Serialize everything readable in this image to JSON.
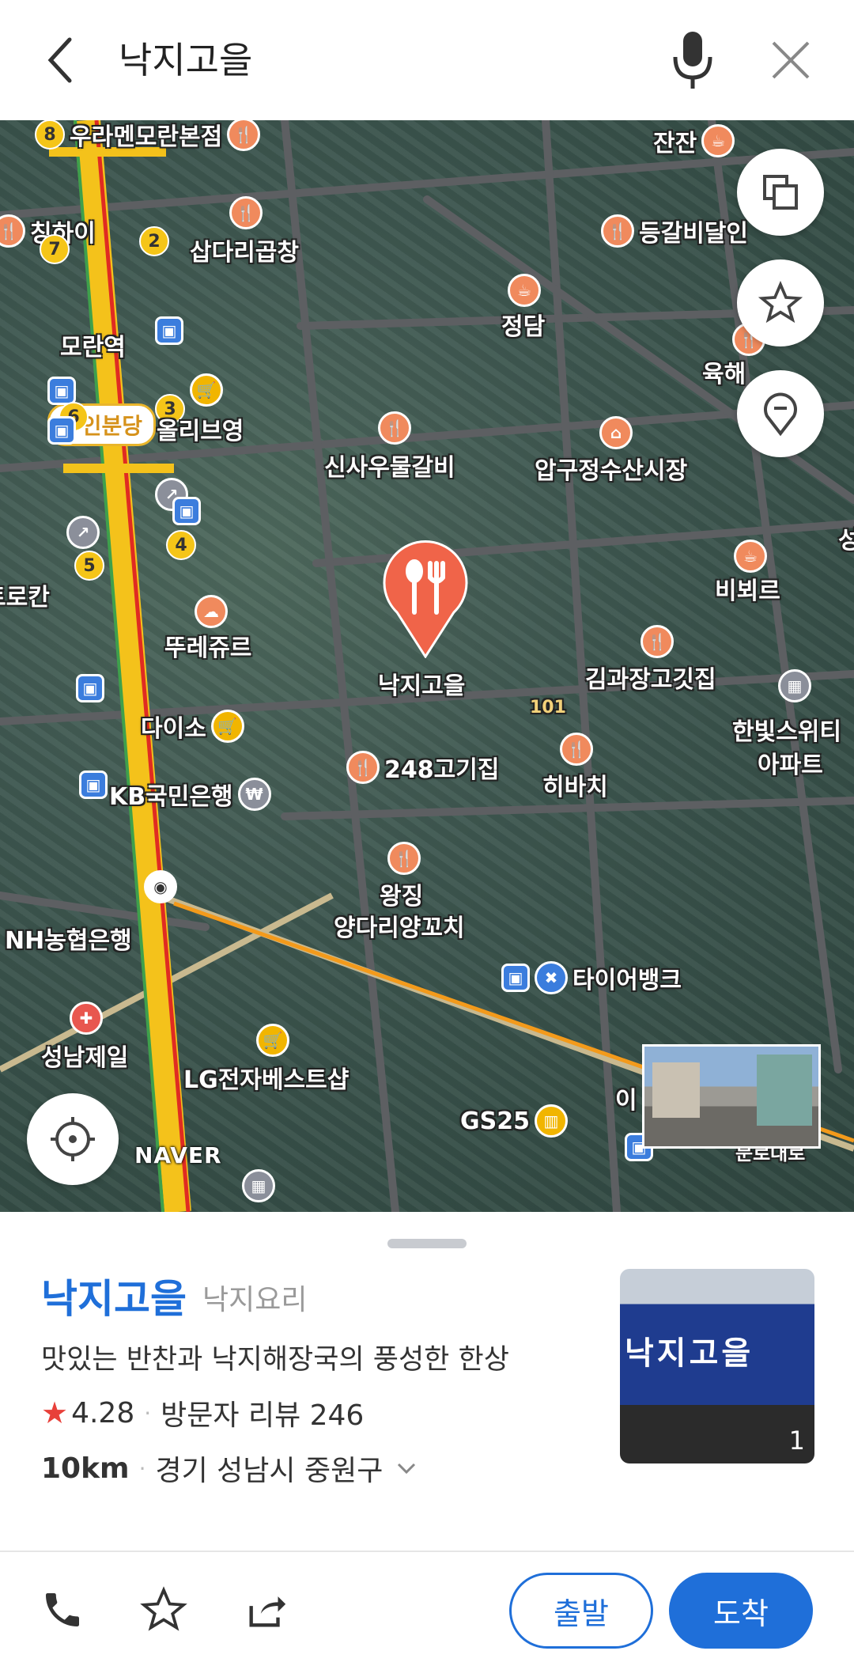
{
  "search": {
    "query": "낙지고을"
  },
  "map": {
    "station_badge": "수인분당",
    "labels": {
      "p1": "우라멘모란본점",
      "p2": "칭하이",
      "p3": "삽다리곱창",
      "p4": "잔잔",
      "p5": "등갈비달인",
      "p6": "정담",
      "p7": "모란역",
      "p8": "올리브영",
      "p9": "육해",
      "p10": "신사우물갈비",
      "p11": "압구정수산시장",
      "p12": "비뵈르",
      "p13": "뚜레쥬르",
      "p14": "트로칸",
      "p15": "김과장고깃집",
      "p16": "한빛스위티",
      "p17": "아파트",
      "p18": "다이소",
      "p19": "248고기집",
      "p20": "히바치",
      "p21": "KB국민은행",
      "p22": "왕징",
      "p23": "양다리양꼬치",
      "p24": "NH농협은행",
      "p25": "타이어뱅크",
      "p26": "성남제일",
      "p27": "LG전자베스트샵",
      "p28": "GS25",
      "p29": "이",
      "p30": "문로대로",
      "selected": "낙지고을",
      "road_no": "101",
      "district": "성"
    },
    "exit_numbers": [
      "8",
      "2",
      "7",
      "6",
      "3",
      "4",
      "5"
    ],
    "naver_logo": "NAVER"
  },
  "place": {
    "name": "낙지고을",
    "category": "낙지요리",
    "description": "맛있는 반찬과 낙지해장국의 풍성한 한상",
    "rating": "4.28",
    "reviews": "방문자 리뷰 246",
    "distance": "10km",
    "address": "경기 성남시 중원구",
    "photo_sign": "낙지고을",
    "photo_count": "1"
  },
  "actions": {
    "depart": "출발",
    "arrive": "도착"
  },
  "colors": {
    "accent": "#1f6fd9",
    "marker": "#f06449",
    "star": "#e8403a"
  }
}
